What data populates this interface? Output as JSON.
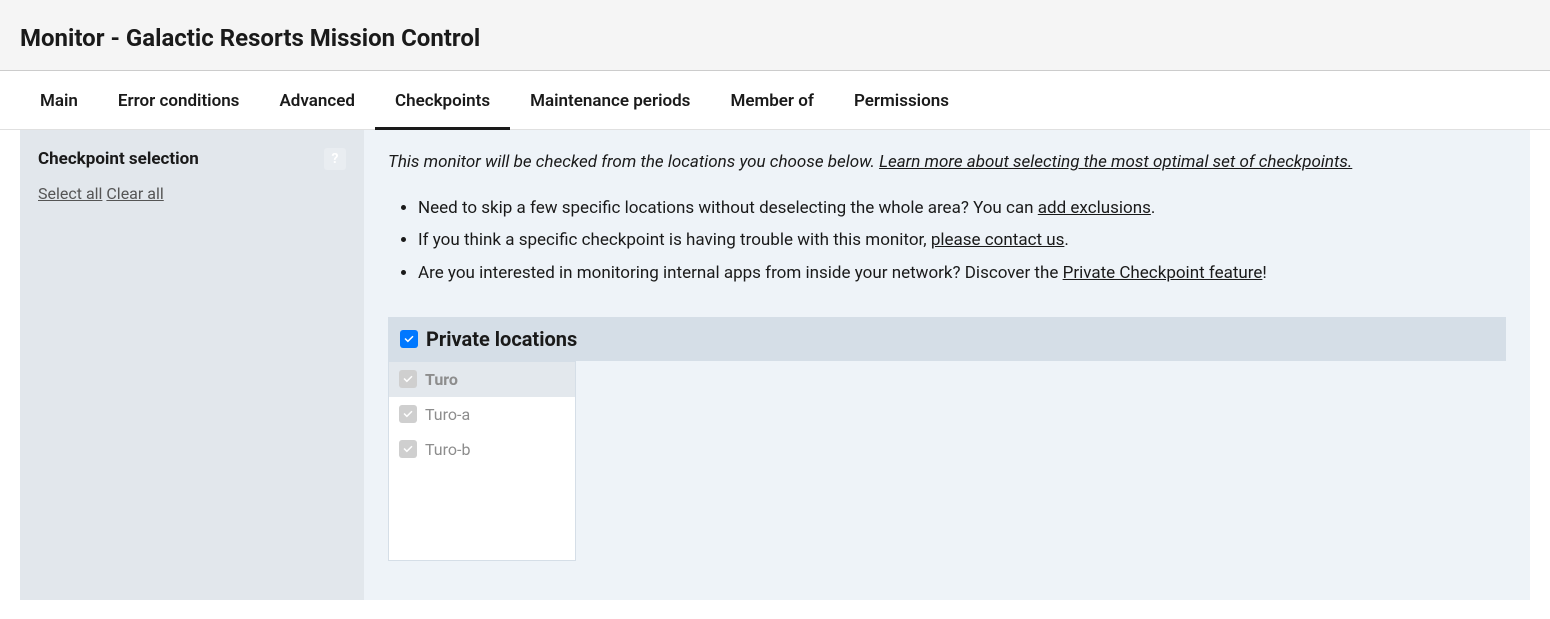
{
  "header": {
    "title": "Monitor - Galactic Resorts Mission Control"
  },
  "tabs": [
    {
      "label": "Main",
      "active": false
    },
    {
      "label": "Error conditions",
      "active": false
    },
    {
      "label": "Advanced",
      "active": false
    },
    {
      "label": "Checkpoints",
      "active": true
    },
    {
      "label": "Maintenance periods",
      "active": false
    },
    {
      "label": "Member of",
      "active": false
    },
    {
      "label": "Permissions",
      "active": false
    }
  ],
  "sidebar": {
    "title": "Checkpoint selection",
    "help_icon": "?",
    "select_all": "Select all",
    "clear_all": "Clear all"
  },
  "intro": {
    "text": "This monitor will be checked from the locations you choose below. ",
    "link": "Learn more about selecting the most optimal set of checkpoints."
  },
  "bullets": [
    {
      "prefix": "Need to skip a few specific locations without deselecting the whole area? You can ",
      "link": "add exclusions",
      "suffix": "."
    },
    {
      "prefix": "If you think a specific checkpoint is having trouble with this monitor, ",
      "link": "please contact us",
      "suffix": "."
    },
    {
      "prefix": "Are you interested in monitoring internal apps from inside your network? Discover the ",
      "link": "Private Checkpoint feature",
      "suffix": "!"
    }
  ],
  "section": {
    "title": "Private locations",
    "checked": true
  },
  "locations": {
    "group": "Turo",
    "items": [
      "Turo-a",
      "Turo-b"
    ]
  }
}
